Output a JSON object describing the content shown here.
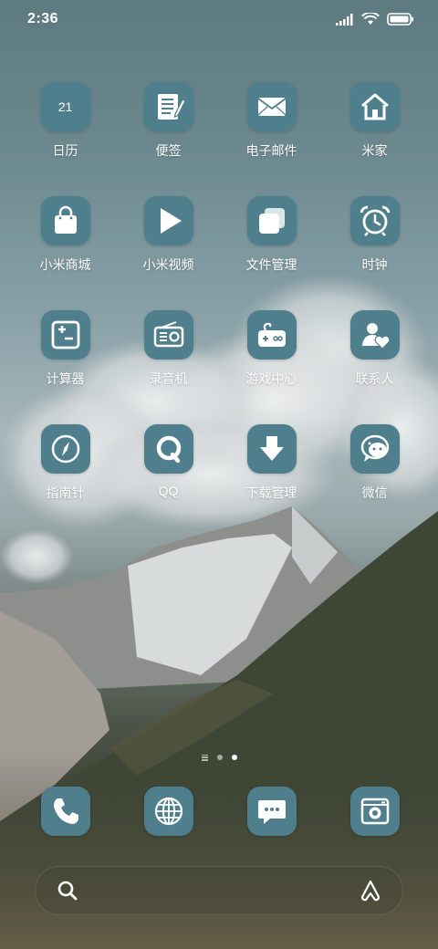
{
  "status_bar": {
    "time": "2:36",
    "icons": [
      "signal-icon",
      "wifi-icon",
      "battery-icon"
    ]
  },
  "apps": [
    {
      "label": "日历",
      "icon": "calendar-icon",
      "day": "21"
    },
    {
      "label": "便签",
      "icon": "notes-icon"
    },
    {
      "label": "电子邮件",
      "icon": "mail-icon"
    },
    {
      "label": "米家",
      "icon": "home-icon"
    },
    {
      "label": "小米商城",
      "icon": "shopping-bag-icon"
    },
    {
      "label": "小米视频",
      "icon": "play-icon"
    },
    {
      "label": "文件管理",
      "icon": "files-icon"
    },
    {
      "label": "时钟",
      "icon": "alarm-clock-icon"
    },
    {
      "label": "计算器",
      "icon": "calculator-icon"
    },
    {
      "label": "录音机",
      "icon": "radio-icon"
    },
    {
      "label": "游戏中心",
      "icon": "gamepad-icon"
    },
    {
      "label": "联系人",
      "icon": "contacts-icon"
    },
    {
      "label": "指南针",
      "icon": "compass-icon"
    },
    {
      "label": "QQ",
      "icon": "qq-icon"
    },
    {
      "label": "下载管理",
      "icon": "download-icon"
    },
    {
      "label": "微信",
      "icon": "wechat-icon"
    }
  ],
  "page_indicator": {
    "pages": 2,
    "active": 2
  },
  "dock": [
    {
      "name": "phone",
      "icon": "phone-icon"
    },
    {
      "name": "browser",
      "icon": "globe-icon"
    },
    {
      "name": "messages",
      "icon": "message-icon"
    },
    {
      "name": "camera",
      "icon": "camera-icon"
    }
  ],
  "search": {
    "left_icon": "search-icon",
    "right_icon": "assistant-icon"
  },
  "colors": {
    "icon_tile": "#4f7f8c",
    "text": "#ffffff"
  }
}
